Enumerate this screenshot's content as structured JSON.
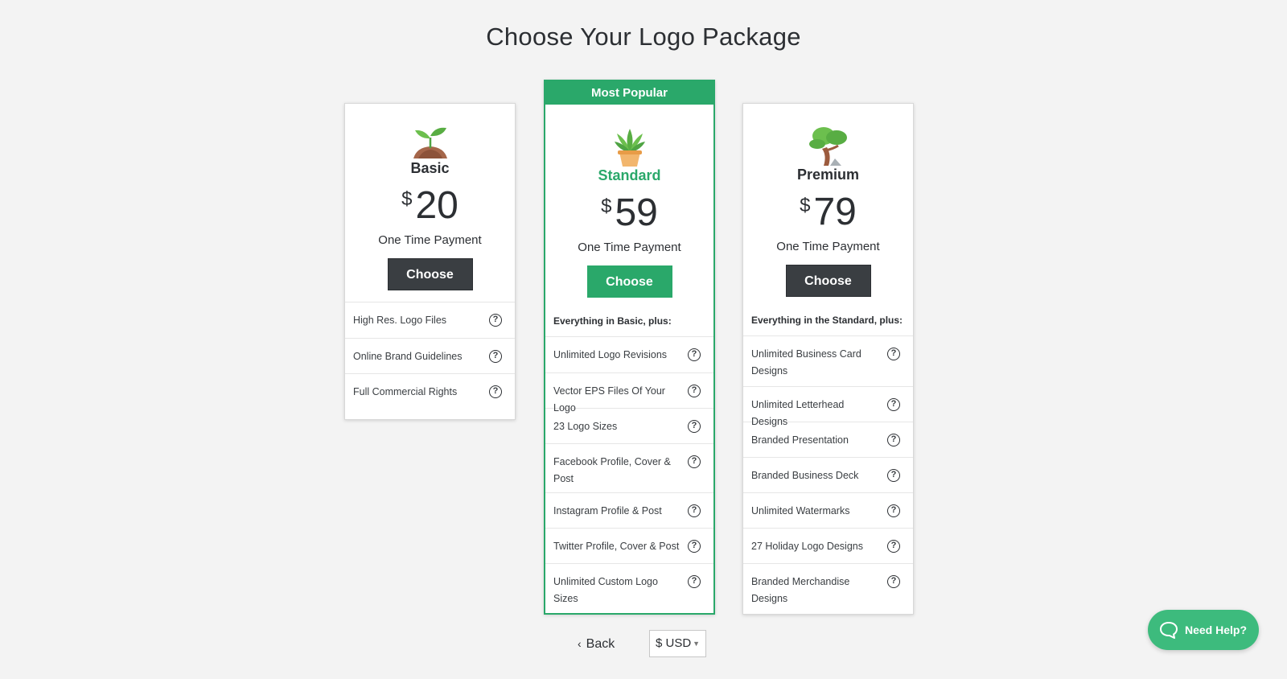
{
  "page_title": "Choose Your Logo Package",
  "plans": {
    "basic": {
      "name": "Basic",
      "currency": "$",
      "price": "20",
      "payment": "One Time Payment",
      "cta": "Choose",
      "icon": "seedling-icon",
      "features": [
        "High Res. Logo Files",
        "Online Brand Guidelines",
        "Full Commercial Rights"
      ]
    },
    "standard": {
      "badge": "Most Popular",
      "name": "Standard",
      "currency": "$",
      "price": "59",
      "payment": "One Time Payment",
      "cta": "Choose",
      "icon": "potted-plant-icon",
      "subtitle": "Everything in Basic, plus:",
      "features": [
        "Unlimited Logo Revisions",
        "Vector EPS Files Of Your Logo",
        "23 Logo Sizes",
        "Facebook Profile, Cover & Post",
        "Instagram Profile & Post",
        "Twitter Profile, Cover & Post",
        "Unlimited Custom Logo Sizes"
      ]
    },
    "premium": {
      "name": "Premium",
      "currency": "$",
      "price": "79",
      "payment": "One Time Payment",
      "cta": "Choose",
      "icon": "tree-icon",
      "subtitle": "Everything in the Standard, plus:",
      "features": [
        "Unlimited Business Card Designs",
        "Unlimited Letterhead Designs",
        "Branded Presentation",
        "Branded Business Deck",
        "Unlimited Watermarks",
        "27 Holiday Logo Designs",
        "Branded Merchandise Designs"
      ]
    }
  },
  "help_glyph": "?",
  "footer": {
    "back_label": "Back",
    "back_icon": "‹",
    "currency_selected": "$ USD",
    "currency_caret": "▼"
  },
  "help_widget": {
    "label": "Need Help?"
  },
  "colors": {
    "accent": "#2aa86a",
    "dark_button": "#3a3e42",
    "background": "#f3f3f3",
    "help_widget": "#3dbb7d"
  }
}
